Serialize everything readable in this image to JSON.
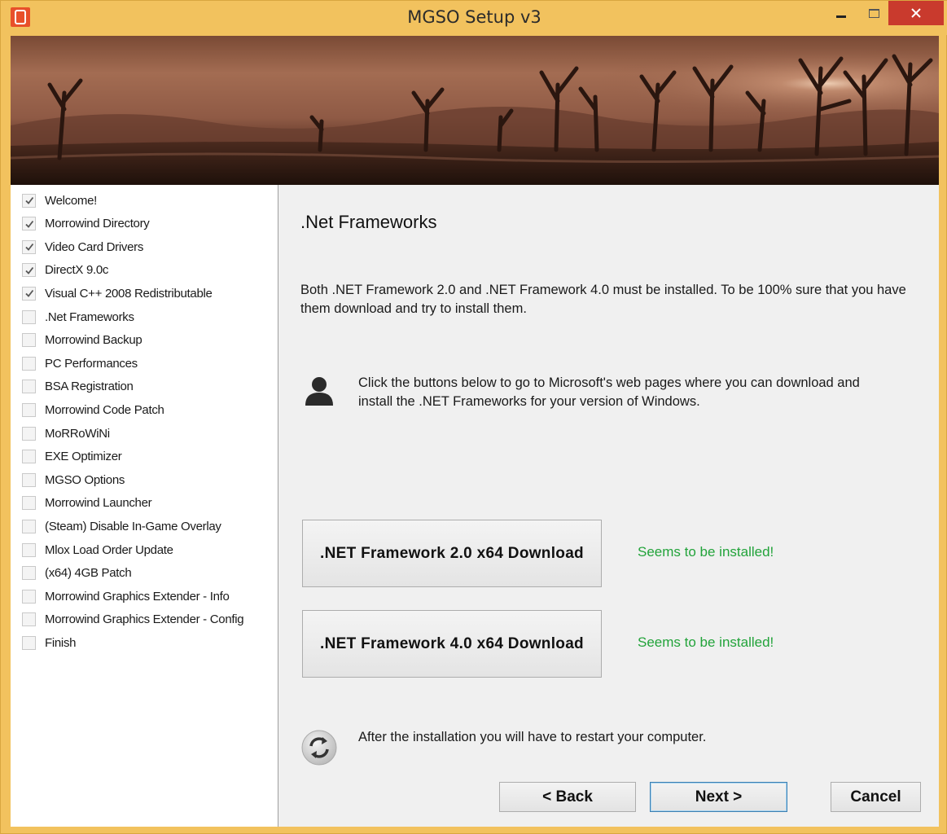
{
  "window": {
    "title": "MGSO Setup v3",
    "accent": "#f2c25e",
    "close_color": "#c93a2d"
  },
  "sidebar": {
    "steps": [
      {
        "label": "Welcome!",
        "checked": true
      },
      {
        "label": "Morrowind Directory",
        "checked": true
      },
      {
        "label": "Video Card Drivers",
        "checked": true
      },
      {
        "label": "DirectX 9.0c",
        "checked": true
      },
      {
        "label": "Visual C++ 2008 Redistributable",
        "checked": true
      },
      {
        "label": ".Net Frameworks",
        "checked": false
      },
      {
        "label": "Morrowind Backup",
        "checked": false
      },
      {
        "label": "PC Performances",
        "checked": false
      },
      {
        "label": "BSA Registration",
        "checked": false
      },
      {
        "label": "Morrowind Code Patch",
        "checked": false
      },
      {
        "label": "MoRRoWiNi",
        "checked": false
      },
      {
        "label": "EXE Optimizer",
        "checked": false
      },
      {
        "label": "MGSO Options",
        "checked": false
      },
      {
        "label": "Morrowind Launcher",
        "checked": false
      },
      {
        "label": "(Steam) Disable In-Game Overlay",
        "checked": false
      },
      {
        "label": "Mlox Load Order Update",
        "checked": false
      },
      {
        "label": "(x64) 4GB Patch",
        "checked": false
      },
      {
        "label": "Morrowind Graphics Extender - Info",
        "checked": false
      },
      {
        "label": "Morrowind Graphics Extender - Config",
        "checked": false
      },
      {
        "label": "Finish",
        "checked": false
      }
    ]
  },
  "main": {
    "heading": ".Net Frameworks",
    "intro": "Both .NET Framework 2.0 and .NET Framework 4.0 must be installed. To be 100% sure that you have them download and try to install them.",
    "instructions": "Click the buttons below to go to Microsoft's web pages where you can download and install the .NET Frameworks for your version of Windows.",
    "downloads": [
      {
        "label": ".NET Framework 2.0 x64 Download",
        "status": "Seems to be installed!"
      },
      {
        "label": ".NET Framework 4.0 x64 Download",
        "status": "Seems to be installed!"
      }
    ],
    "status_color": "#22a33a",
    "restart_note": "After the installation you will have to restart your computer."
  },
  "nav": {
    "back": "< Back",
    "next": "Next >",
    "cancel": "Cancel"
  },
  "icons": {
    "app": "app-icon",
    "user": "user-icon",
    "refresh": "refresh-icon",
    "check": "check-icon"
  }
}
